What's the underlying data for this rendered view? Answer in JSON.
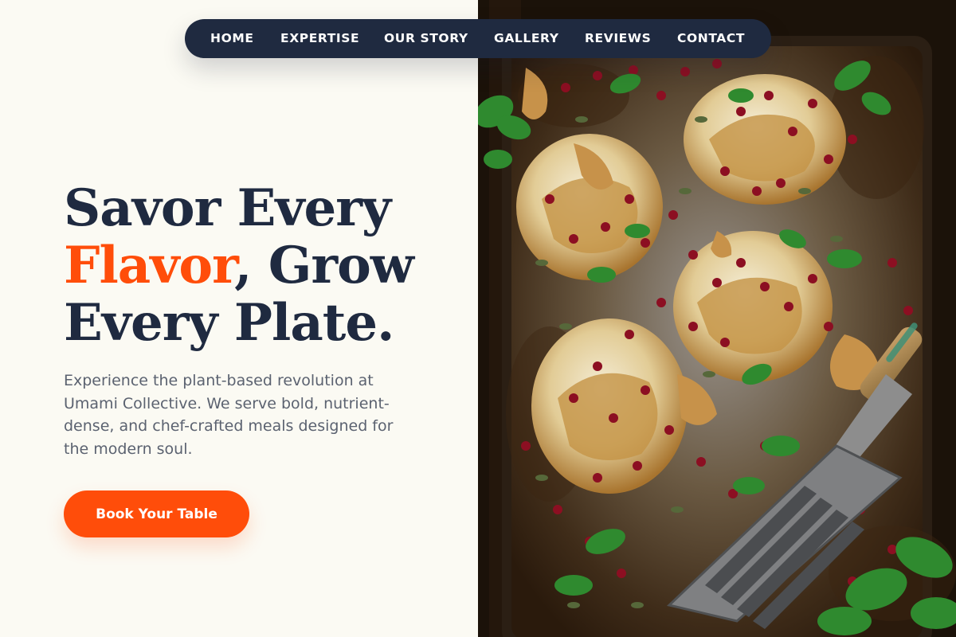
{
  "nav": {
    "items": [
      {
        "label": "HOME"
      },
      {
        "label": "EXPERTISE"
      },
      {
        "label": "OUR STORY"
      },
      {
        "label": "GALLERY"
      },
      {
        "label": "REVIEWS"
      },
      {
        "label": "CONTACT"
      }
    ]
  },
  "hero": {
    "headline": {
      "line1": "Savor Every",
      "accent_word": "Flavor",
      "line2_rest": ", Grow",
      "line3": "Every Plate."
    },
    "description": "Experience the plant-based revolution at Umami Collective. We serve bold, nutrient-dense, and chef-crafted meals designed for the modern soul.",
    "cta_label": "Book Your Table"
  },
  "photo": {
    "subject": "roasted-cauliflower-steaks-on-sheet-pan",
    "icon": "food-photo"
  },
  "colors": {
    "background": "#fbfaf3",
    "navy": "#1f2a40",
    "accent": "#ff4d0a",
    "body_text": "#5b6270",
    "white": "#ffffff"
  }
}
